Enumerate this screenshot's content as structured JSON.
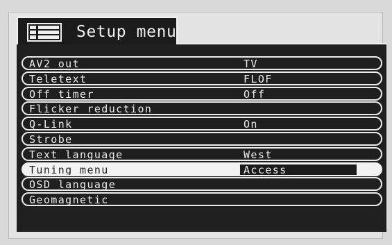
{
  "title": "Setup menu",
  "menu": [
    {
      "label": "AV2 out",
      "value": "TV"
    },
    {
      "label": "Teletext",
      "value": "FLOF"
    },
    {
      "label": "Off timer",
      "value": "Off"
    },
    {
      "label": "Flicker reduction",
      "value": ""
    },
    {
      "label": "Q-Link",
      "value": "On"
    },
    {
      "label": "Strobe",
      "value": ""
    },
    {
      "label": "Text language",
      "value": "West"
    },
    {
      "label": "Tuning menu",
      "value": "Access",
      "selected": true
    },
    {
      "label": "OSD language",
      "value": ""
    },
    {
      "label": "Geomagnetic",
      "value": ""
    }
  ],
  "icons": {
    "menu_icon": "menu-list-icon"
  },
  "colors": {
    "panel": "#202020",
    "highlight": "#f2f2f2",
    "text": "#eeeeee"
  }
}
